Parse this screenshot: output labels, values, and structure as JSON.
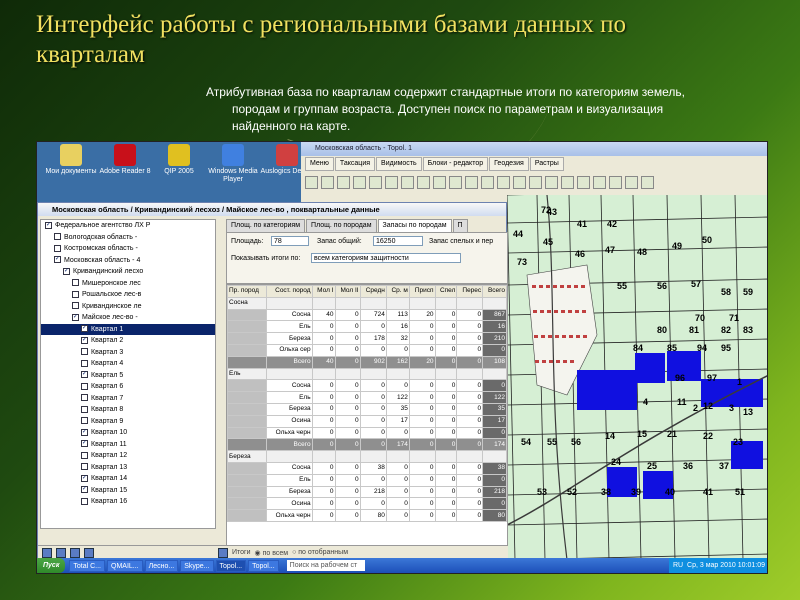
{
  "slide": {
    "title": "Интерфейс работы с региональными базами данных по кварталам",
    "desc_lines": [
      "Атрибутивная база по кварталам содержит стандартные итоги по категориям земель,",
      "породам и группам возраста. Доступен поиск по параметрам и визуализация",
      "найденного на карте."
    ]
  },
  "desktop_icons": [
    {
      "label": "Мои документы",
      "icon": "folder-icon",
      "color": "#e8d060"
    },
    {
      "label": "Adobe Reader 8",
      "icon": "adobe-reader-icon",
      "color": "#c8101a"
    },
    {
      "label": "QIP 2005",
      "icon": "qip-icon",
      "color": "#e0c020"
    },
    {
      "label": "Windows Media Player",
      "icon": "media-player-icon",
      "color": "#4080e0"
    },
    {
      "label": "Auslogics Defrag",
      "icon": "defrag-icon",
      "color": "#d04040"
    }
  ],
  "topol": {
    "title": "Московская область - Topol. 1",
    "menu": [
      "Меню",
      "Таксация",
      "Видимость",
      "Блоки - редактор",
      "Геодезия",
      "Растры"
    ]
  },
  "datawin": {
    "title": "Московская область / Кривандинский лесхоз / Майское лес-во , поквартальные данные",
    "tree": [
      {
        "label": "Федеральное агентство ЛХ Р",
        "level": 0,
        "checked": true
      },
      {
        "label": "Вологодская область -",
        "level": 1,
        "checked": false
      },
      {
        "label": "Костромская область -",
        "level": 1,
        "checked": false
      },
      {
        "label": "Московская область - 4",
        "level": 1,
        "checked": true
      },
      {
        "label": "Кривандинский лесхо",
        "level": 2,
        "checked": true
      },
      {
        "label": "Мишеронское лес",
        "level": 3,
        "checked": false
      },
      {
        "label": "Рошальское лес-в",
        "level": 3,
        "checked": false
      },
      {
        "label": "Кривандинское ле",
        "level": 3,
        "checked": false
      },
      {
        "label": "Майское лес-во -",
        "level": 3,
        "checked": true
      },
      {
        "label": "Квартал 1",
        "level": 4,
        "checked": true,
        "selected": true
      },
      {
        "label": "Квартал 2",
        "level": 4,
        "checked": true
      },
      {
        "label": "Квартал 3",
        "level": 4,
        "checked": false
      },
      {
        "label": "Квартал 4",
        "level": 4,
        "checked": false
      },
      {
        "label": "Квартал 5",
        "level": 4,
        "checked": true
      },
      {
        "label": "Квартал 6",
        "level": 4,
        "checked": false
      },
      {
        "label": "Квартал 7",
        "level": 4,
        "checked": false
      },
      {
        "label": "Квартал 8",
        "level": 4,
        "checked": false
      },
      {
        "label": "Квартал 9",
        "level": 4,
        "checked": false
      },
      {
        "label": "Квартал 10",
        "level": 4,
        "checked": true
      },
      {
        "label": "Квартал 11",
        "level": 4,
        "checked": true
      },
      {
        "label": "Квартал 12",
        "level": 4,
        "checked": false
      },
      {
        "label": "Квартал 13",
        "level": 4,
        "checked": false
      },
      {
        "label": "Квартал 14",
        "level": 4,
        "checked": true
      },
      {
        "label": "Квартал 15",
        "level": 4,
        "checked": true
      },
      {
        "label": "Квартал 16",
        "level": 4,
        "checked": false
      }
    ],
    "tabs": [
      "Площ. по категориям",
      "Площ. по породам",
      "Запасы по породам",
      "П"
    ],
    "form": {
      "area_label": "Площадь:",
      "area_value": "78",
      "stock_label": "Запас общий:",
      "stock_value": "16250",
      "ripe_label": "Запас спелых и пер",
      "show_label": "Показывать итоги по:",
      "show_value": "всем категориям защитности"
    },
    "grid_headers": [
      "Пр. пород",
      "Сост. пород",
      "Мол I",
      "Мол II",
      "Средн",
      "Ср. м",
      "Присп",
      "Спел",
      "Перес",
      "Всего"
    ],
    "grid_rows": [
      {
        "type": "grp",
        "cells": [
          "Сосна",
          "",
          "",
          "",
          "",
          "",
          "",
          "",
          "",
          ""
        ]
      },
      {
        "type": "row",
        "cells": [
          "",
          "Сосна",
          "40",
          "0",
          "724",
          "113",
          "20",
          "0",
          "0",
          "867"
        ]
      },
      {
        "type": "row",
        "cells": [
          "",
          "Ель",
          "0",
          "0",
          "0",
          "16",
          "0",
          "0",
          "0",
          "16"
        ]
      },
      {
        "type": "row",
        "cells": [
          "",
          "Береза",
          "0",
          "0",
          "178",
          "32",
          "0",
          "0",
          "0",
          "210"
        ]
      },
      {
        "type": "row",
        "cells": [
          "",
          "Ольха сер",
          "0",
          "0",
          "0",
          "0",
          "0",
          "0",
          "0",
          "0"
        ]
      },
      {
        "type": "tot",
        "cells": [
          "",
          "Всего",
          "40",
          "0",
          "902",
          "162",
          "20",
          "0",
          "0",
          "108"
        ]
      },
      {
        "type": "grp",
        "cells": [
          "Ель",
          "",
          "",
          "",
          "",
          "",
          "",
          "",
          "",
          ""
        ]
      },
      {
        "type": "row",
        "cells": [
          "",
          "Сосна",
          "0",
          "0",
          "0",
          "0",
          "0",
          "0",
          "0",
          "0"
        ]
      },
      {
        "type": "row",
        "cells": [
          "",
          "Ель",
          "0",
          "0",
          "0",
          "122",
          "0",
          "0",
          "0",
          "122"
        ]
      },
      {
        "type": "row",
        "cells": [
          "",
          "Береза",
          "0",
          "0",
          "0",
          "35",
          "0",
          "0",
          "0",
          "35"
        ]
      },
      {
        "type": "row",
        "cells": [
          "",
          "Осина",
          "0",
          "0",
          "0",
          "17",
          "0",
          "0",
          "0",
          "17"
        ]
      },
      {
        "type": "row",
        "cells": [
          "",
          "Ольха черн",
          "0",
          "0",
          "0",
          "0",
          "0",
          "0",
          "0",
          "0"
        ]
      },
      {
        "type": "tot",
        "cells": [
          "",
          "Всего",
          "0",
          "0",
          "0",
          "174",
          "0",
          "0",
          "0",
          "174"
        ]
      },
      {
        "type": "grp",
        "cells": [
          "Береза",
          "",
          "",
          "",
          "",
          "",
          "",
          "",
          "",
          ""
        ]
      },
      {
        "type": "row",
        "cells": [
          "",
          "Сосна",
          "0",
          "0",
          "38",
          "0",
          "0",
          "0",
          "0",
          "38"
        ]
      },
      {
        "type": "row",
        "cells": [
          "",
          "Ель",
          "0",
          "0",
          "0",
          "0",
          "0",
          "0",
          "0",
          "0"
        ]
      },
      {
        "type": "row",
        "cells": [
          "",
          "Береза",
          "0",
          "0",
          "218",
          "0",
          "0",
          "0",
          "0",
          "218"
        ]
      },
      {
        "type": "row",
        "cells": [
          "",
          "Осина",
          "0",
          "0",
          "0",
          "0",
          "0",
          "0",
          "0",
          "0"
        ]
      },
      {
        "type": "row",
        "cells": [
          "",
          "Ольха черн",
          "0",
          "0",
          "80",
          "0",
          "0",
          "0",
          "0",
          "80"
        ]
      }
    ],
    "bottom": {
      "totals_label": "Итоги",
      "all_label": "по всем",
      "selected_label": "по отобранным"
    }
  },
  "map": {
    "numbers": [
      "43",
      "41",
      "42",
      "44",
      "45",
      "46",
      "47",
      "48",
      "49",
      "50",
      "55",
      "56",
      "57",
      "58",
      "59",
      "70",
      "71",
      "72",
      "73",
      "80",
      "81",
      "82",
      "83",
      "84",
      "85",
      "94",
      "95",
      "96",
      "97",
      "1",
      "2",
      "3",
      "4",
      "11",
      "12",
      "13",
      "14",
      "15",
      "21",
      "22",
      "23",
      "24",
      "25",
      "36",
      "37",
      "38",
      "39",
      "40",
      "41",
      "51",
      "52",
      "53",
      "54",
      "55",
      "56"
    ],
    "highlight_color": "#1010e0"
  },
  "taskbar": {
    "start": "Пуск",
    "tasks": [
      "Total C...",
      "QMAIL...",
      "Лесно...",
      "Skype...",
      "Topol...",
      "Topol..."
    ],
    "search_placeholder": "Поиск на рабочем ст",
    "lang": "RU",
    "clock": "Ср, 3 мар 2010  10:01:09"
  }
}
